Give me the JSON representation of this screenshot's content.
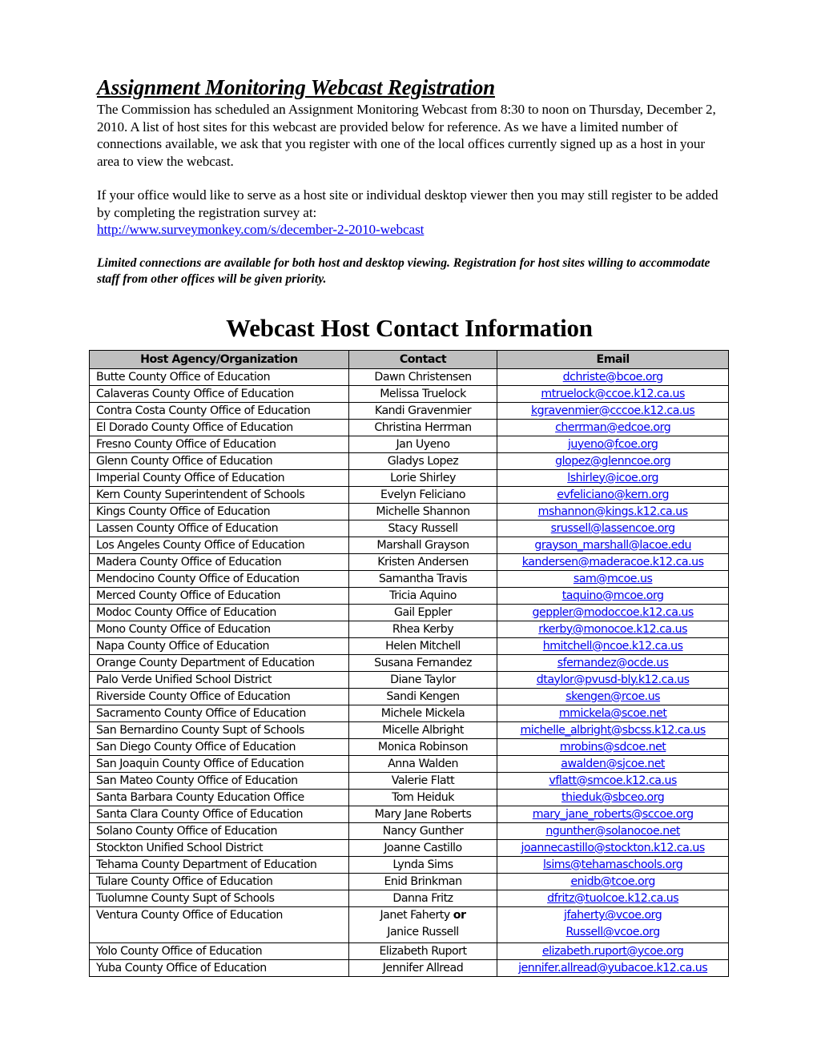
{
  "document": {
    "title": "Assignment Monitoring Webcast Registration",
    "intro": "The Commission has scheduled an Assignment Monitoring Webcast from 8:30 to noon on Thursday, December 2, 2010. A list of host sites for this webcast are provided below for reference.  As we have a limited number of connections available, we ask that you register with one of the local offices currently signed up as a host in your area to view the webcast.",
    "register_text": "If your office would like to serve as a host site or individual desktop viewer then you may still register to be added by completing the registration survey at:",
    "survey_link": "http://www.surveymonkey.com/s/december-2-2010-webcast",
    "note": "Limited connections are available for both host and desktop viewing.  Registration for host sites willing to accommodate staff from other offices will be given priority.",
    "section_title": "Webcast Host Contact Information"
  },
  "colors": {
    "link": "#0000ee",
    "header_bg": "#bfbfbf"
  },
  "table": {
    "headers": [
      "Host Agency/Organization",
      "Contact",
      "Email"
    ],
    "rows": [
      {
        "agency": "Butte County Office of Education",
        "contact": "Dawn Christensen",
        "email": "dchriste@bcoe.org"
      },
      {
        "agency": "Calaveras County Office of Education",
        "contact": "Melissa Truelock",
        "email": "mtruelock@ccoe.k12.ca.us"
      },
      {
        "agency": "Contra Costa County Office of Education",
        "contact": "Kandi Gravenmier",
        "email": "kgravenmier@cccoe.k12.ca.us"
      },
      {
        "agency": "El Dorado County Office of Education",
        "contact": "Christina Herrman",
        "email": "cherrman@edcoe.org"
      },
      {
        "agency": "Fresno County Office of Education",
        "contact": "Jan Uyeno",
        "email": "juyeno@fcoe.org"
      },
      {
        "agency": "Glenn County Office of Education",
        "contact": "Gladys Lopez",
        "email": "glopez@glenncoe.org"
      },
      {
        "agency": "Imperial County Office of Education",
        "contact": "Lorie Shirley",
        "email": "lshirley@icoe.org"
      },
      {
        "agency": "Kern County Superintendent of Schools",
        "contact": "Evelyn Feliciano",
        "email": "evfeliciano@kern.org"
      },
      {
        "agency": "Kings County Office of Education",
        "contact": "Michelle Shannon",
        "email": "mshannon@kings.k12.ca.us"
      },
      {
        "agency": "Lassen County Office of Education",
        "contact": "Stacy Russell",
        "email": "srussell@lassencoe.org"
      },
      {
        "agency": "Los Angeles County Office of Education",
        "contact": "Marshall Grayson",
        "email": "grayson_marshall@lacoe.edu"
      },
      {
        "agency": "Madera County Office of Education",
        "contact": "Kristen Andersen",
        "email": "kandersen@maderacoe.k12.ca.us"
      },
      {
        "agency": "Mendocino County Office of Education",
        "contact": "Samantha Travis",
        "email": "sam@mcoe.us"
      },
      {
        "agency": "Merced County Office of Education",
        "contact": "Tricia Aquino",
        "email": "taquino@mcoe.org"
      },
      {
        "agency": "Modoc County Office of Education",
        "contact": "Gail Eppler",
        "email": "geppler@modoccoe.k12.ca.us"
      },
      {
        "agency": "Mono County Office of Education",
        "contact": "Rhea Kerby",
        "email": "rkerby@monocoe.k12.ca.us"
      },
      {
        "agency": "Napa County Office of Education",
        "contact": "Helen Mitchell",
        "email": "hmitchell@ncoe.k12.ca.us"
      },
      {
        "agency": "Orange County Department of Education",
        "contact": "Susana Fernandez",
        "email": "sfernandez@ocde.us"
      },
      {
        "agency": "Palo Verde Unified School District",
        "contact": "Diane Taylor",
        "email": "dtaylor@pvusd-bly.k12.ca.us"
      },
      {
        "agency": "Riverside County Office of Education",
        "contact": "Sandi Kengen",
        "email": "skengen@rcoe.us"
      },
      {
        "agency": "Sacramento County Office of Education",
        "contact": "Michele Mickela",
        "email": "mmickela@scoe.net"
      },
      {
        "agency": "San Bernardino County Supt of Schools",
        "contact": "Micelle Albright",
        "email": "michelle_albright@sbcss.k12.ca.us"
      },
      {
        "agency": "San Diego County Office of Education",
        "contact": "Monica Robinson",
        "email": "mrobins@sdcoe.net"
      },
      {
        "agency": "San Joaquin County Office of Education",
        "contact": "Anna Walden",
        "email": "awalden@sjcoe.net"
      },
      {
        "agency": "San Mateo County Office of Education",
        "contact": "Valerie Flatt",
        "email": "vflatt@smcoe.k12.ca.us"
      },
      {
        "agency": "Santa Barbara County Education Office",
        "contact": "Tom Heiduk",
        "email": "thieduk@sbceo.org"
      },
      {
        "agency": "Santa Clara County Office of Education",
        "contact": "Mary Jane Roberts",
        "email": "mary_jane_roberts@sccoe.org"
      },
      {
        "agency": "Solano County Office of Education",
        "contact": "Nancy Gunther",
        "email": "ngunther@solanocoe.net"
      },
      {
        "agency": "Stockton Unified School District",
        "contact": "Joanne Castillo",
        "email": "joannecastillo@stockton.k12.ca.us"
      },
      {
        "agency": "Tehama County Department of Education",
        "contact": "Lynda Sims",
        "email": "lsims@tehamaschools.org"
      },
      {
        "agency": "Tulare County Office of Education",
        "contact": "Enid Brinkman",
        "email": "enidb@tcoe.org"
      },
      {
        "agency": "Tuolumne County Supt of Schools",
        "contact": "Danna Fritz",
        "email": "dfritz@tuolcoe.k12.ca.us"
      }
    ],
    "ventura": {
      "agency": "Ventura County Office of Education",
      "contact_1": "Janet Faherty",
      "or_label": "or",
      "contact_2": "Janice Russell",
      "email_1": "jfaherty@vcoe.org",
      "email_2": "Russell@vcoe.org"
    },
    "rows_after": [
      {
        "agency": "Yolo County Office of Education",
        "contact": "Elizabeth Ruport",
        "email": "elizabeth.ruport@ycoe.org"
      },
      {
        "agency": "Yuba County Office of Education",
        "contact": "Jennifer Allread",
        "email": "jennifer.allread@yubacoe.k12.ca.us"
      }
    ]
  }
}
